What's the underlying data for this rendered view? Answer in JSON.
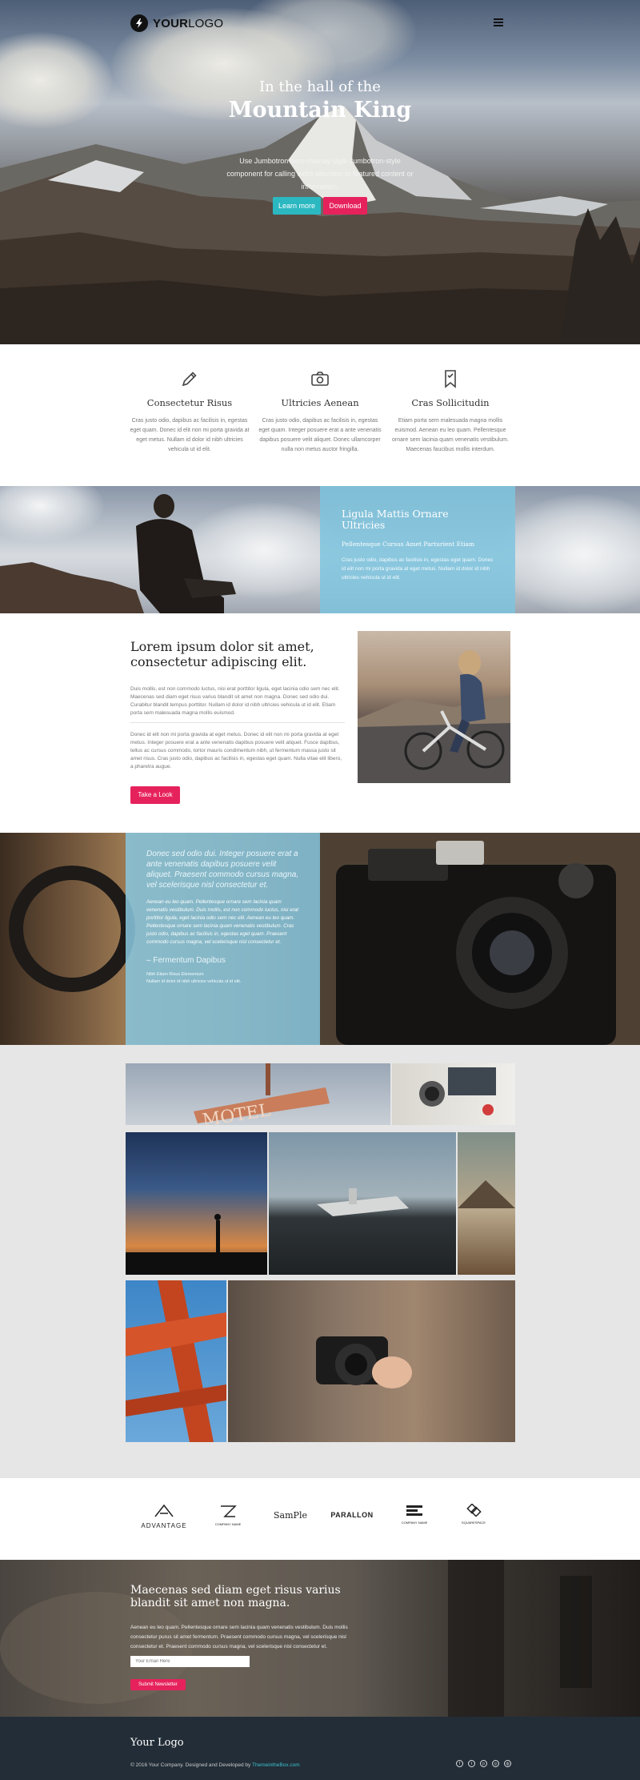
{
  "header": {
    "logo_bold": "YOUR",
    "logo_thin": "LOGO"
  },
  "hero": {
    "title_line1": "In the hall of the",
    "title_line2": "Mountain King",
    "subtitle": "Use Jumbotron hero-overlay-style Jumbotron-style component for calling extra attention to featured content or information.",
    "learn_more": "Learn more",
    "download": "Download"
  },
  "features": [
    {
      "icon": "pencil-icon",
      "title": "Consectetur Risus",
      "text": "Cras justo odio, dapibus ac facilisis in, egestas eget quam. Donec id elit non mi porta gravida at eget metus. Nullam id dolor id nibh ultricies vehicula ut id elit."
    },
    {
      "icon": "camera-icon",
      "title": "Ultricies Aenean",
      "text": "Cras justo odio, dapibus ac facilisis in, egestas eget quam. Integer posuere erat a ante venenatis dapibus posuere velit aliquet. Donec ullamcorper nulla non metus auctor fringilla."
    },
    {
      "icon": "bookmark-icon",
      "title": "Cras Sollicitudin",
      "text": "Etiam porta sem malesuada magna mollis euismod. Aenean eu leo quam. Pellentesque ornare sem lacinia quam venenatis vestibulum. Maecenas faucibus mollis interdum."
    }
  ],
  "band": {
    "title": "Ligula Mattis Ornare Ultricies",
    "subtitle": "Pellentesque Cursus Amet Parturient Etiam",
    "text": "Cras justo odio, dapibus ac facilisis in, egestas eget quam. Donec id elit non mi porta gravida at eget metus. Nullam id dolor id nibh ultricies vehicula ut id elit."
  },
  "lorem": {
    "title": "Lorem ipsum dolor sit amet, consectetur adipiscing elit.",
    "p1": "Duis mollis, est non commodo luctus, nisi erat porttitor ligula, eget lacinia odio sem nec elit. Maecenas sed diam eget risus varius blandit sit amet non magna. Donec sed odio dui. Curabitur blandit tempus porttitor. Nullam id dolor id nibh ultricies vehicula ut id elit. Etiam porta sem malesuada magna mollis euismod.",
    "p2": "Donec id elit non mi porta gravida at eget metus. Donec id elit non mi porta gravida at eget metus. Integer posuere erat a ante venenatis dapibus posuere velit aliquet. Fusce dapibus, tellus ac cursus commodo, tortor mauris condimentum nibh, ut fermentum massa justo sit amet risus. Cras justo odio, dapibus ac facilisis in, egestas eget quam. Nulla vitae elit libero, a pharetra augue.",
    "button": "Take a Look"
  },
  "camera": {
    "quote": "Donec sed odio dui. Integer posuere erat a ante venenatis dapibus posuere velit aliquet. Praesent commodo cursus magna, vel scelerisque nisl consectetur et.",
    "text": "Aenean eu leo quam. Pellentesque ornare sem lacinia quam venenatis vestibulum. Duis mollis, est non commodo luctus, nisi erat porttitor ligula, eget lacinia odio sem nec elit. Aenean eu leo quam. Pellentesque ornare sem lacinia quam venenatis vestibulum. Cras justo odio, dapibus ac facilisis in, egestas eget quam. Praesent commodo cursus magna, vel scelerisque nisl consectetur et.",
    "author": "– Fermentum Dapibus",
    "meta_line1": "Nibh Etiam Risus Elementum",
    "meta_line2": "Nullam id dolor id nibh ultricies vehicula ut id elit."
  },
  "brands": [
    "ADVANTAGE",
    "COMPANY NAME",
    "SamPle",
    "PARALLON",
    "COMPANY NAME",
    "SQUARESPACE"
  ],
  "newsletter": {
    "title": "Maecenas sed diam eget risus varius blandit sit amet non magna.",
    "text": "Aenean eu leo quam. Pellentesque ornare sem lacinia quam venenatis vestibulum. Duis mollis consectetur purus sit amet fermentum. Praesent commodo cursus magna, vel scelerisque nisl consectetur et. Praesent commodo cursus magna, vel scelerisque nisl consectetur et.",
    "placeholder": "Your Email Here",
    "button": "Submit Newsletter"
  },
  "footer": {
    "title": "Your Logo",
    "copyright": "© 2016 Your Company. Designed and Developed by ",
    "credit_link": "ThemeintheBox.com",
    "social_icons": [
      "facebook-icon",
      "twitter-icon",
      "pinterest-icon",
      "instagram-icon",
      "dribbble-icon"
    ]
  },
  "colors": {
    "teal": "#2bb8c1",
    "pink": "#e6225c",
    "light_blue": "#7ec4de",
    "footer_bg": "#222d37"
  }
}
